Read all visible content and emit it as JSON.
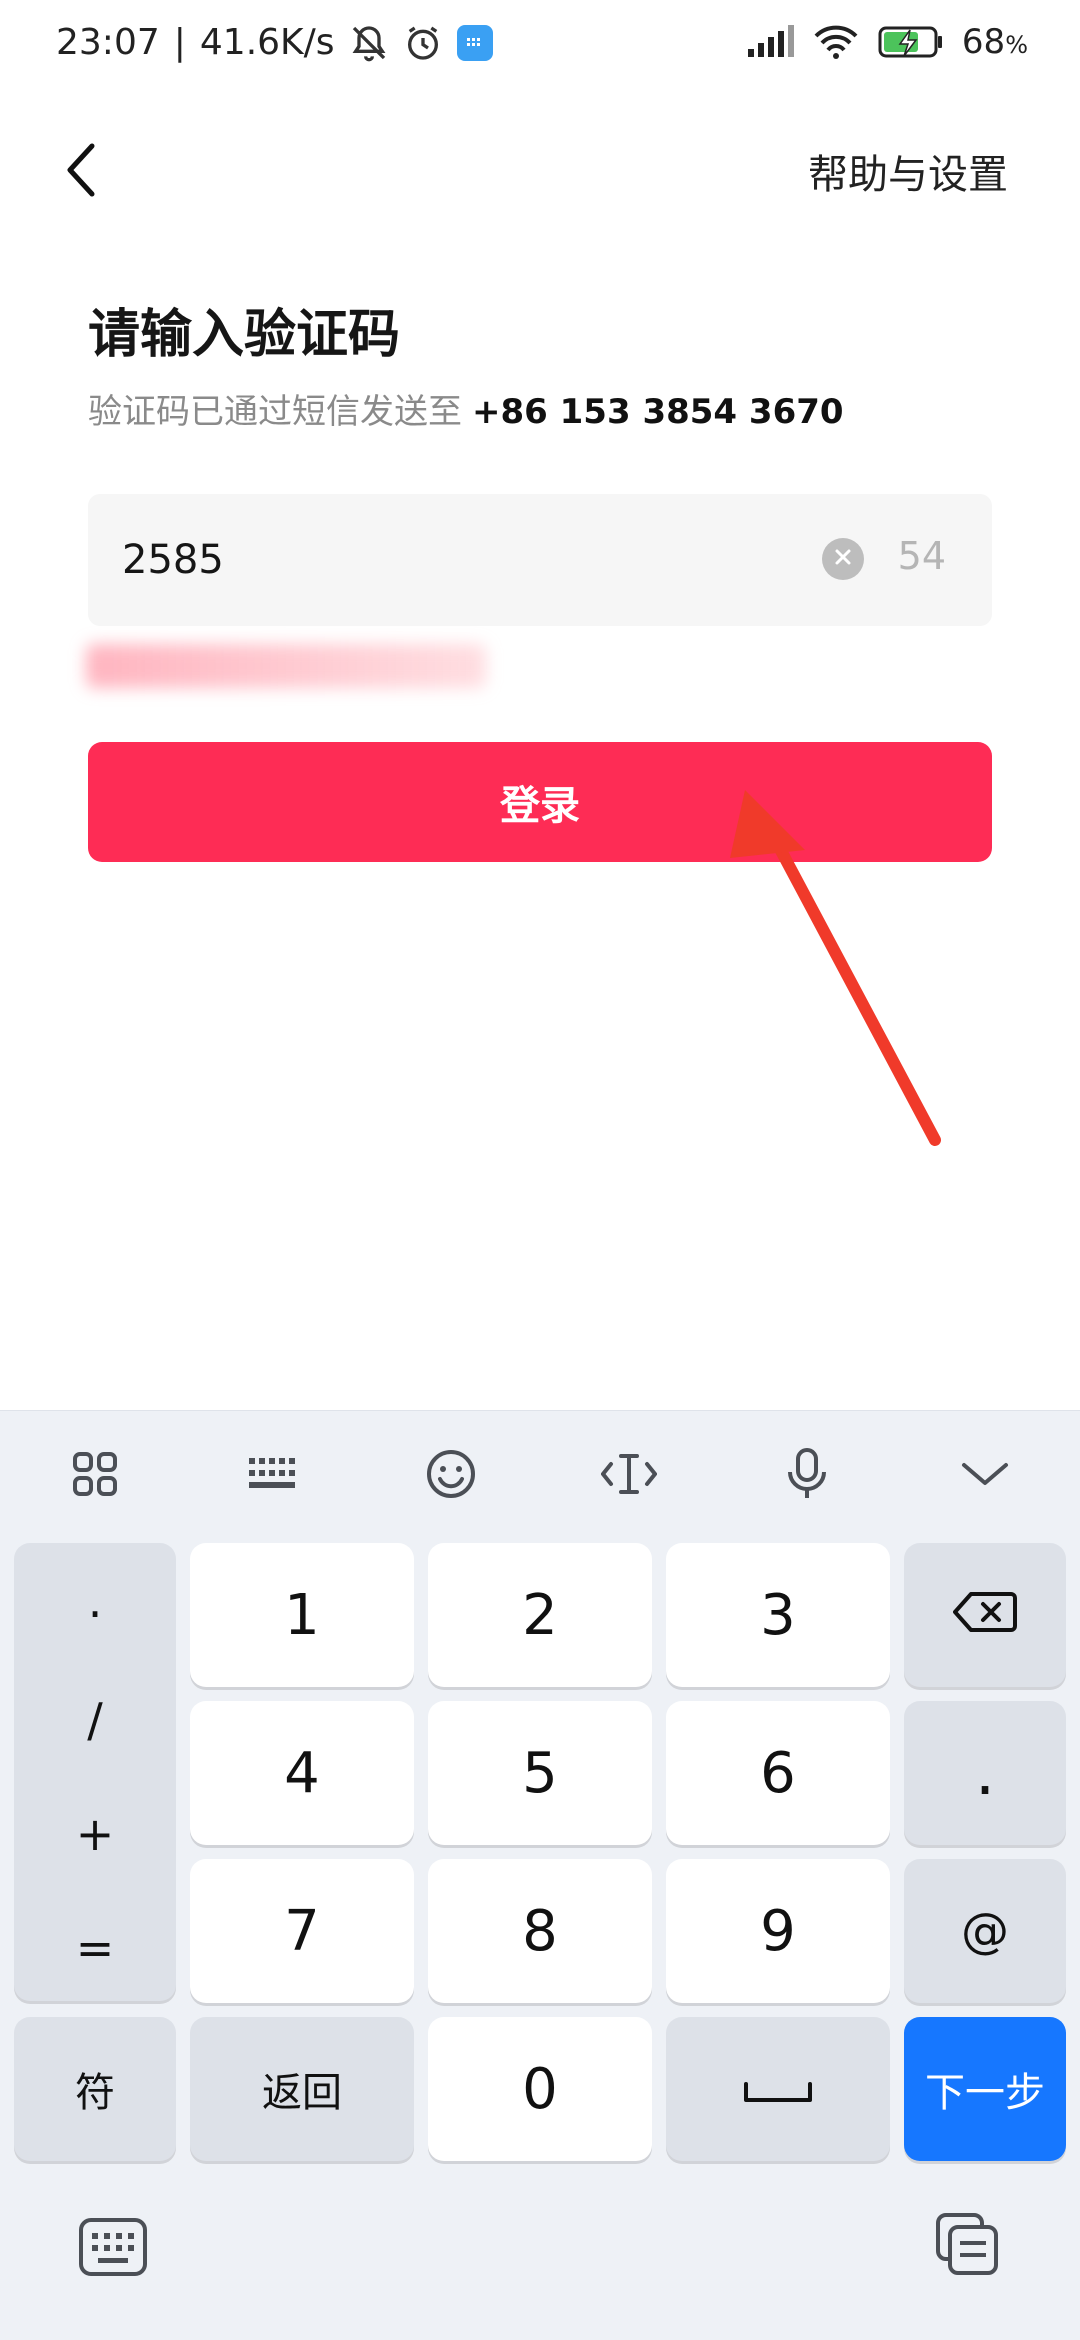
{
  "status_bar": {
    "time": "23:07",
    "network_speed": "41.6K/s",
    "battery": "68",
    "battery_unit": "%",
    "icons": [
      "bell-muted-icon",
      "alarm-icon",
      "app-badge-icon",
      "signal-icon",
      "wifi-icon",
      "battery-charging-icon"
    ]
  },
  "header": {
    "back_icon": "chevron-left-icon",
    "help_label": "帮助与设置"
  },
  "content": {
    "title": "请输入验证码",
    "subtitle_prefix": "验证码已通过短信发送至",
    "phone": "+86 153 3854 3670",
    "code_value": "2585",
    "countdown": "54",
    "login_label": "登录"
  },
  "keyboard": {
    "toolbar_icons": [
      "grid-icon",
      "keyboard-icon",
      "emoji-icon",
      "cursor-icon",
      "mic-icon",
      "chevron-down-icon"
    ],
    "symbols": [
      "·",
      "/",
      "+",
      "="
    ],
    "keys": {
      "k1": "1",
      "k2": "2",
      "k3": "3",
      "k4": "4",
      "k5": "5",
      "k6": "6",
      "k7": "7",
      "k8": "8",
      "k9": "9",
      "k0": "0",
      "dot": ".",
      "at": "@",
      "fu": "符",
      "back": "返回",
      "next": "下一步"
    }
  },
  "colors": {
    "accent": "#fe2c55",
    "keyboard_blue": "#1677ff",
    "annotation_arrow": "#f03a2a"
  }
}
